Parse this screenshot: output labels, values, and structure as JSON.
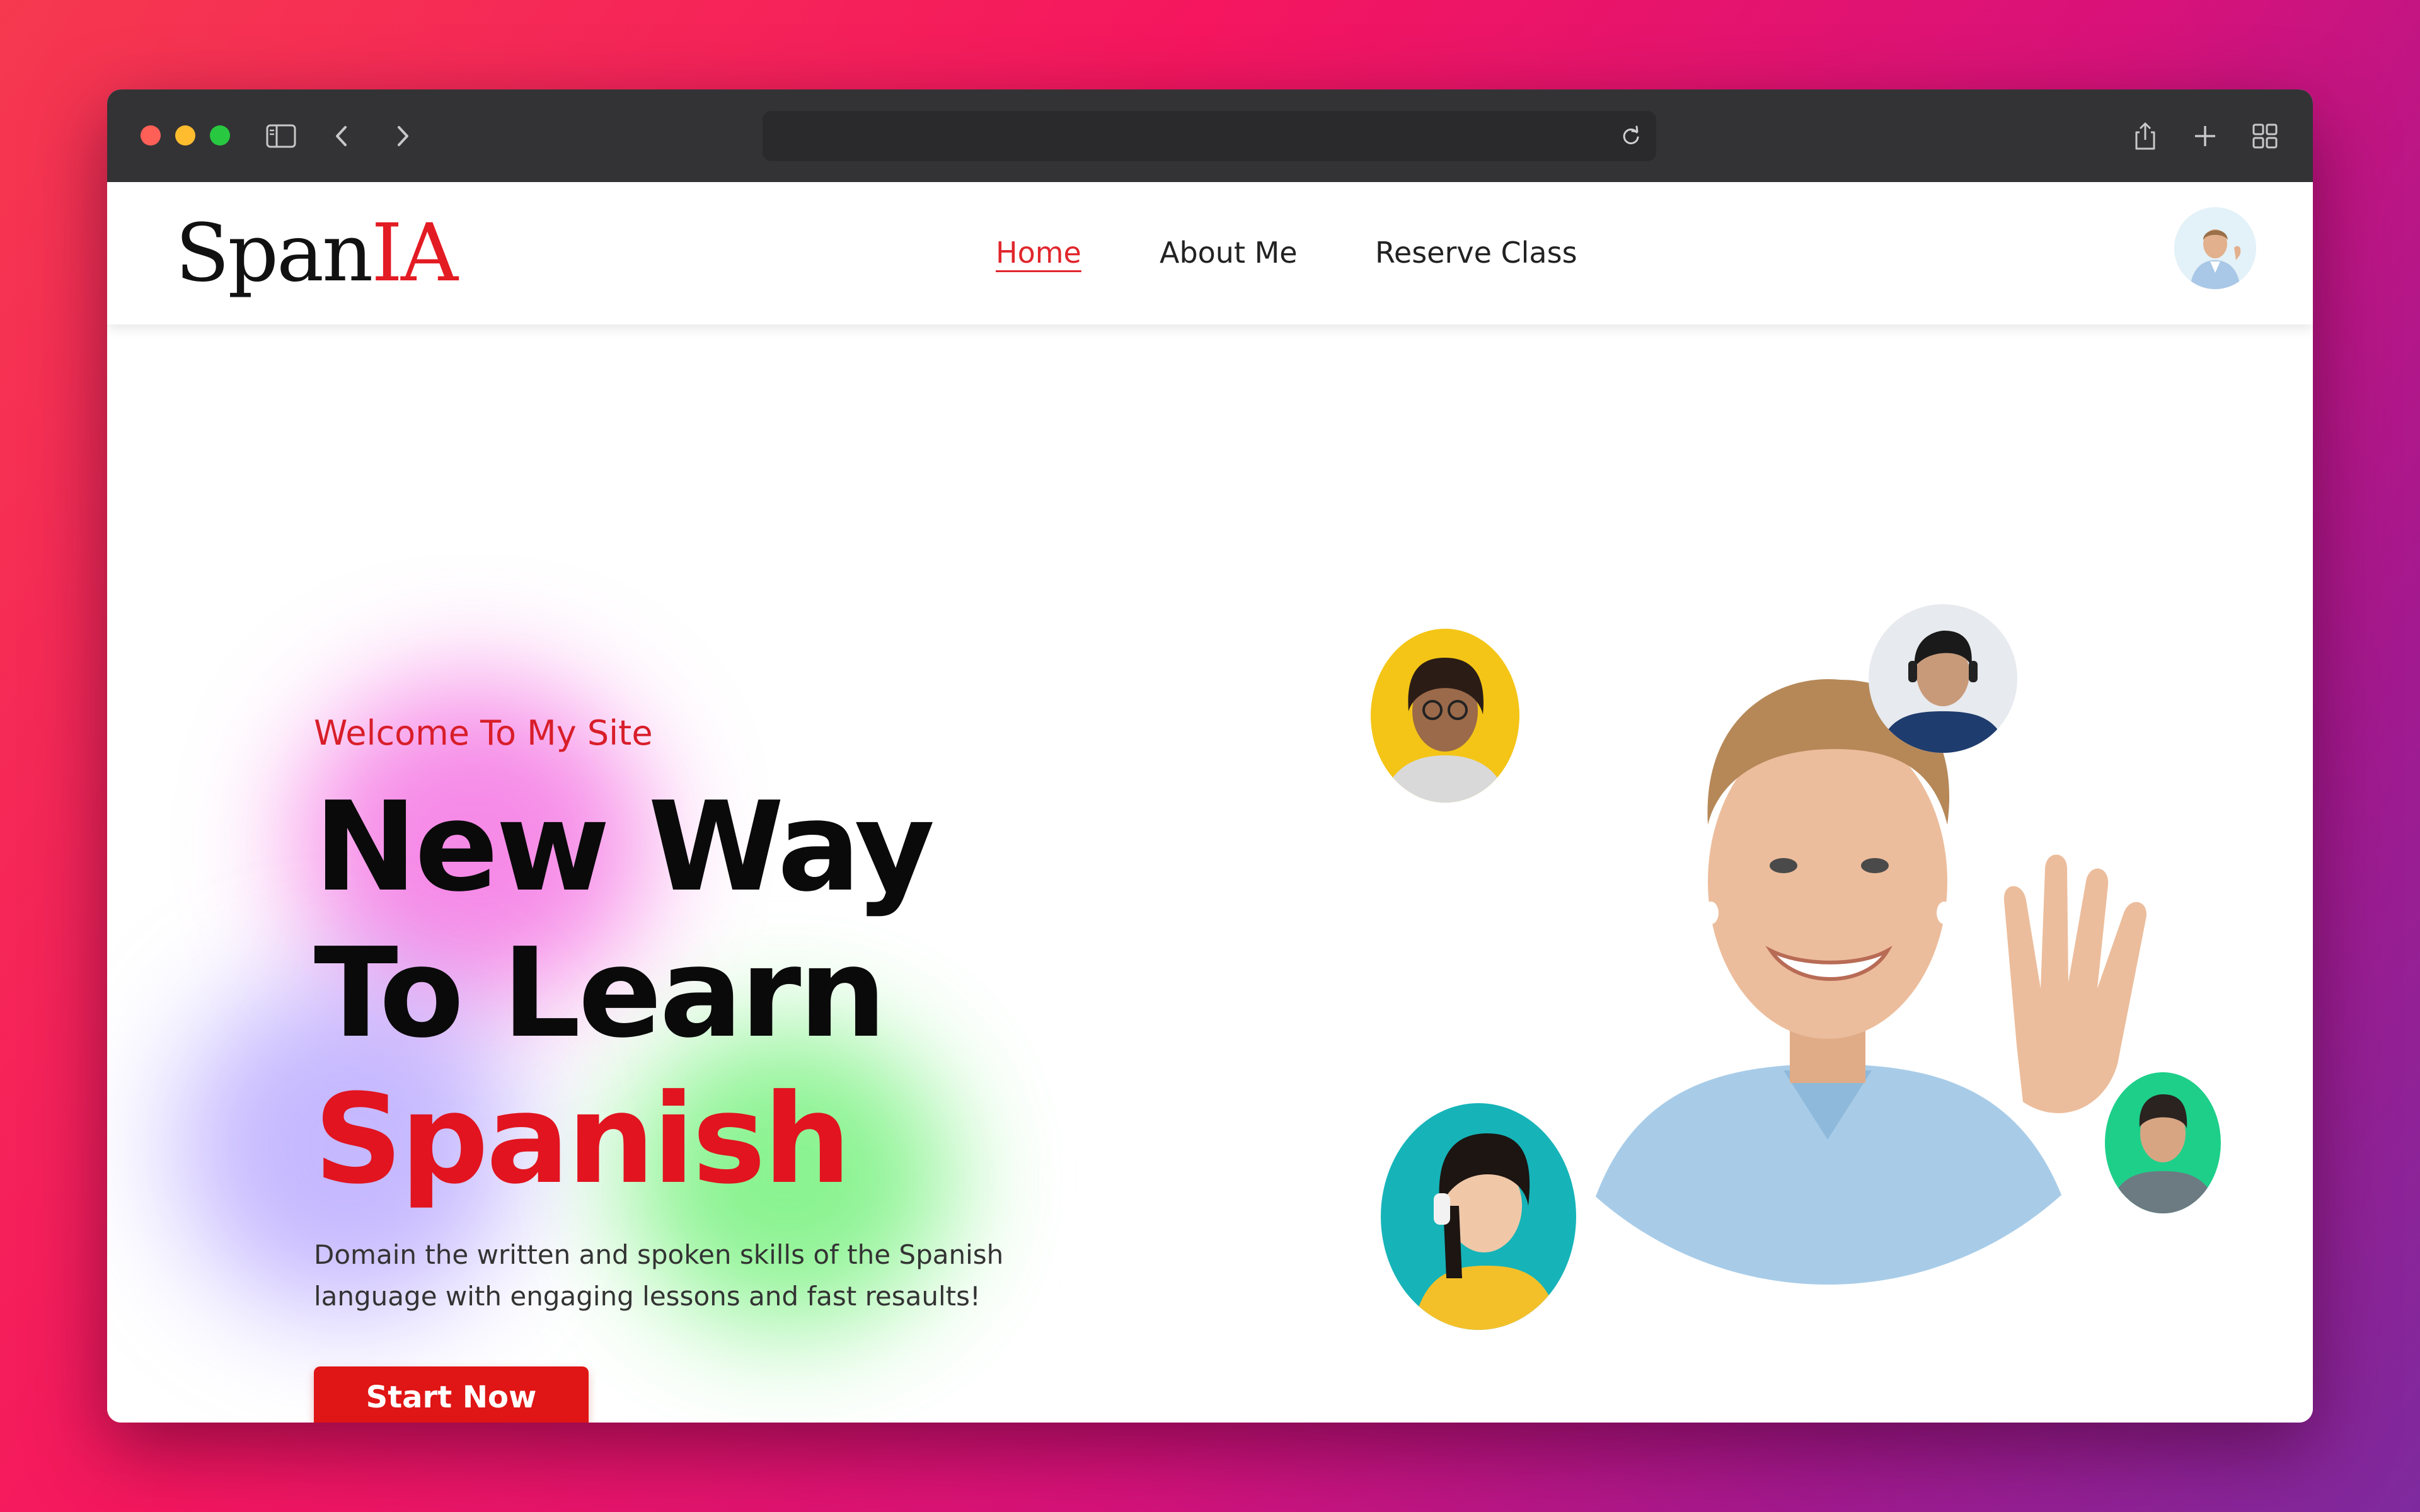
{
  "browser": {
    "traffic_lights": {
      "close": "#fe5f57",
      "minimize": "#febc2e",
      "zoom": "#28c840"
    },
    "url": ""
  },
  "site": {
    "logo": {
      "main": "Span",
      "accent": "IA"
    },
    "nav": [
      {
        "label": "Home",
        "active": true
      },
      {
        "label": "About Me",
        "active": false
      },
      {
        "label": "Reserve Class",
        "active": false
      }
    ],
    "brand_color": "#e31b23"
  },
  "hero": {
    "eyebrow": "Welcome To My Site",
    "headline_line1": "New Way",
    "headline_line2": "To Learn",
    "headline_accent": "Spanish",
    "subtext": "Domain the written and spoken skills of the Spanish language with engaging lessons and fast resaults!",
    "cta_label": "Start Now"
  }
}
